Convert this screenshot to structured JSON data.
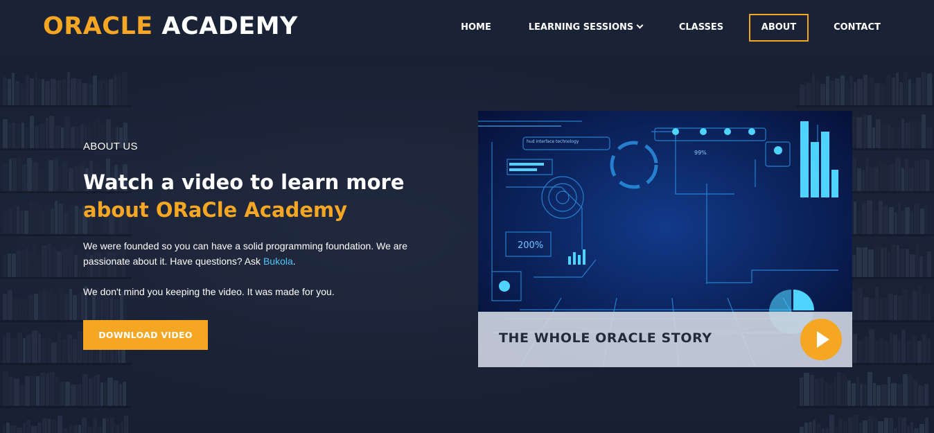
{
  "brand": {
    "part1": "ORACLE",
    "part2": "ACADEMY"
  },
  "nav": {
    "items": [
      {
        "label": "HOME"
      },
      {
        "label": "LEARNING SESSIONS"
      },
      {
        "label": "CLASSES"
      },
      {
        "label": "ABOUT"
      },
      {
        "label": "CONTACT"
      }
    ],
    "active": "ABOUT"
  },
  "hero": {
    "eyebrow": "ABOUT US",
    "headline_line1": "Watch a video to learn more",
    "headline_line2": "about ORaCle Academy",
    "para1_before": "We were founded so you can have a solid programming foundation. We are passionate about it. Have questions? Ask ",
    "para1_link": "Bukola",
    "para1_after": ".",
    "para2": "We don't mind you keeping the video. It was made for you.",
    "button_label": "DOWNLOAD VIDEO"
  },
  "video": {
    "caption": "THE WHOLE ORACLE STORY",
    "hud_label_1": "hud interface technology",
    "hud_percent_small": "99%",
    "hud_percent_big": "200%"
  },
  "colors": {
    "accent": "#f5a623",
    "link": "#4fc3f7",
    "header_bg": "#1a2236"
  }
}
